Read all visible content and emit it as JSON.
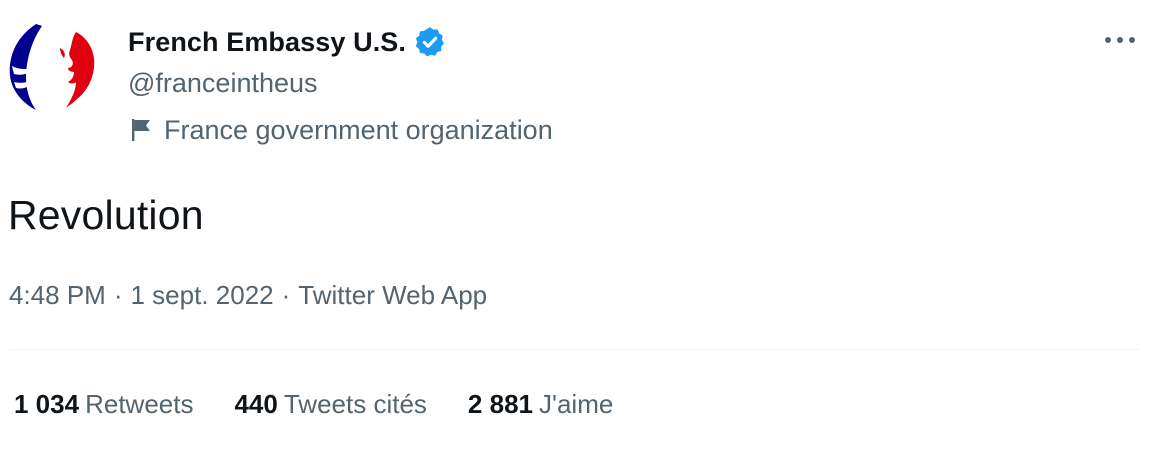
{
  "author": {
    "display_name": "French Embassy U.S.",
    "handle": "@franceintheus",
    "label": "France government organization",
    "verified": true
  },
  "tweet": {
    "text": "Revolution",
    "time": "4:48 PM",
    "date": "1 sept. 2022",
    "source": "Twitter Web App",
    "separator": "·"
  },
  "stats": [
    {
      "count": "1 034",
      "label": "Retweets"
    },
    {
      "count": "440",
      "label": "Tweets cités"
    },
    {
      "count": "2 881",
      "label": "J'aime"
    }
  ],
  "icons": {
    "avatar": "marianne-logo",
    "verified": "verified-badge-icon",
    "label": "flag-icon",
    "more": "more-options-icon"
  },
  "colors": {
    "primary_text": "#0f1419",
    "secondary_text": "#536471",
    "verified_blue": "#1d9bf0",
    "marianne_blue": "#000091",
    "marianne_red": "#e1000f",
    "divider": "#eff3f4"
  }
}
